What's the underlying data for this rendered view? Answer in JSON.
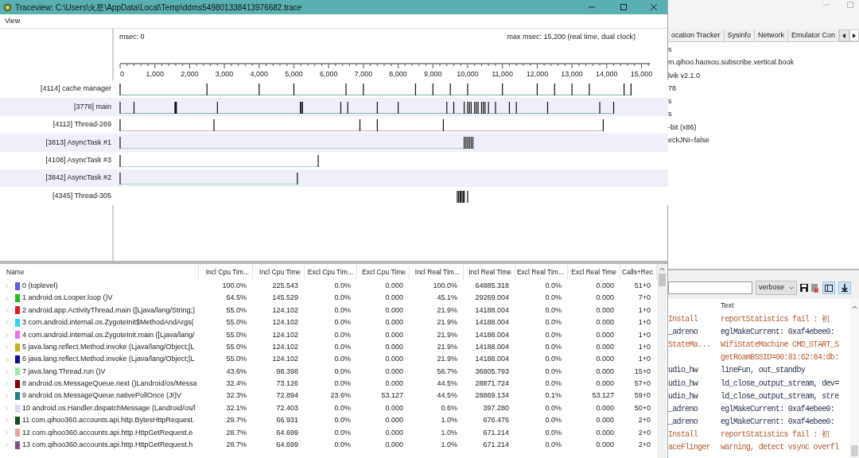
{
  "window": {
    "title": "Traceview: C:\\Users\\火星\\AppData\\Local\\Temp\\ddms549801338413976682.trace"
  },
  "menu": [
    "View"
  ],
  "timeline": {
    "msec": "msec: 0",
    "max_msec": "max msec: 15,200 (real time, dual clock)",
    "axis_labels": [
      "0",
      "1,000",
      "2,000",
      "3,000",
      "4,000",
      "5,000",
      "6,000",
      "7,000",
      "8,000",
      "9,000",
      "10,000",
      "11,000",
      "12,000",
      "13,000",
      "14,000",
      "15,000"
    ],
    "threads": [
      {
        "label": "[4114] cache manager"
      },
      {
        "label": "[3778] main"
      },
      {
        "label": "[4112] Thread-269"
      },
      {
        "label": "[3813] AsyncTask #1"
      },
      {
        "label": "[4108] AsyncTask #3"
      },
      {
        "label": "[3842] AsyncTask #2"
      },
      {
        "label": "[4345] Thread-305"
      }
    ]
  },
  "profile_table": {
    "columns": [
      "Name",
      "Incl Cpu Tim...",
      "Incl Cpu Time",
      "Excl Cpu Tim...",
      "Excl Cpu Time",
      "Incl Real Tim...",
      "Incl Real Time",
      "Excl Real Tim...",
      "Excl Real Time",
      "Calls+Rec"
    ],
    "rows": [
      {
        "color": "#5f5fe6",
        "cells": [
          "0 (toplevel)",
          "100.0%",
          "225.543",
          "0.0%",
          "0.000",
          "100.0%",
          "64885.318",
          "0.0%",
          "0.000",
          "51+0"
        ]
      },
      {
        "color": "#1fc01f",
        "cells": [
          "1 android.os.Looper.loop ()V",
          "64.5%",
          "145.529",
          "0.0%",
          "0.000",
          "45.1%",
          "29269.004",
          "0.0%",
          "0.000",
          "7+0"
        ]
      },
      {
        "color": "#e01f1f",
        "cells": [
          "2 android.app.ActivityThread.main ([Ljava/lang/String;)",
          "55.0%",
          "124.102",
          "0.0%",
          "0.000",
          "21.9%",
          "14188.004",
          "0.0%",
          "0.000",
          "1+0"
        ]
      },
      {
        "color": "#2fd4f2",
        "cells": [
          "3 com.android.internal.os.ZygoteInit$MethodAndArgs(",
          "55.0%",
          "124.102",
          "0.0%",
          "0.000",
          "21.9%",
          "14188.004",
          "0.0%",
          "0.000",
          "1+0"
        ]
      },
      {
        "color": "#f070ec",
        "cells": [
          "4 com.android.internal.os.ZygoteInit.main ([Ljava/lang/",
          "55.0%",
          "124.102",
          "0.0%",
          "0.000",
          "21.9%",
          "14188.004",
          "0.0%",
          "0.000",
          "1+0"
        ]
      },
      {
        "color": "#c8b01e",
        "cells": [
          "5 java.lang.reflect.Method.invoke (Ljava/lang/Object;[L",
          "55.0%",
          "124.102",
          "0.0%",
          "0.000",
          "21.9%",
          "14188.004",
          "0.0%",
          "0.000",
          "1+0"
        ]
      },
      {
        "color": "#10109e",
        "cells": [
          "6 java.lang.reflect.Method.invoke (Ljava/lang/Object;[L",
          "55.0%",
          "124.102",
          "0.0%",
          "0.000",
          "21.9%",
          "14188.004",
          "0.0%",
          "0.000",
          "1+0"
        ]
      },
      {
        "color": "#a2e8a2",
        "cells": [
          "7 java.lang.Thread.run ()V",
          "43.6%",
          "98.398",
          "0.0%",
          "0.000",
          "56.7%",
          "36805.793",
          "0.0%",
          "0.000",
          "15+0"
        ]
      },
      {
        "color": "#800000",
        "cells": [
          "8 android.os.MessageQueue.next ()Landroid/os/Messa",
          "32.4%",
          "73.126",
          "0.0%",
          "0.000",
          "44.5%",
          "28871.724",
          "0.0%",
          "0.000",
          "57+0"
        ]
      },
      {
        "color": "#1f7f8f",
        "cells": [
          "9 android.os.MessageQueue.nativePollOnce (JI)V",
          "32.3%",
          "72.894",
          "23.6%",
          "53.127",
          "44.5%",
          "28869.134",
          "0.1%",
          "53.127",
          "59+0"
        ]
      },
      {
        "color": "#d8d8f2",
        "cells": [
          "10 android.os.Handler.dispatchMessage (Landroid/os/l",
          "32.1%",
          "72.403",
          "0.0%",
          "0.000",
          "0.6%",
          "397.280",
          "0.0%",
          "0.000",
          "50+0"
        ]
      },
      {
        "color": "#0f4f0f",
        "cells": [
          "11 com.qihoo360.accounts.api.http.BytesHttpRequest.",
          "29.7%",
          "66.931",
          "0.0%",
          "0.000",
          "1.0%",
          "676.476",
          "0.0%",
          "0.000",
          "2+0"
        ]
      },
      {
        "color": "#f2a2a2",
        "cells": [
          "12 com.qihoo360.accounts.api.http.HttpGetRequest.e",
          "28.7%",
          "64.699",
          "0.0%",
          "0.000",
          "1.0%",
          "671.214",
          "0.0%",
          "0.000",
          "2+0"
        ]
      },
      {
        "color": "#805080",
        "cells": [
          "13 com.qihoo360.accounts.api.http.HttpGetRequest.h",
          "28.7%",
          "64.699",
          "0.0%",
          "0.000",
          "1.0%",
          "671.214",
          "0.0%",
          "0.000",
          "2+0"
        ]
      }
    ]
  },
  "ddms": {
    "tabs": [
      "ocation Tracker",
      "Sysinfo",
      "Network",
      "Emulator Con"
    ],
    "info_lines": [
      "s",
      "m.qihoo.haosou.subscribe.vertical.book",
      "lvik v2.1.0",
      "78",
      "s",
      "s",
      "-bit (x86)",
      "eckJNI=false"
    ],
    "log": {
      "level": "verbose",
      "columns": [
        "Text"
      ],
      "rows": [
        {
          "tag": "Install",
          "text": "reportStatistics fail : 初",
          "kind": "warn"
        },
        {
          "tag": "_adreno",
          "text": "eglMakeCurrent: 0xaf4ebee0:",
          "kind": "debug"
        },
        {
          "tag": "StateMa...",
          "text": "WifiStateMachine CMD_START_S",
          "kind": "warn"
        },
        {
          "text": "getRoamBSSID=00:81:62:84:db:",
          "kind": "warn"
        },
        {
          "tag": "udio_hw",
          "text": "lineFun, out_standby",
          "kind": "debug"
        },
        {
          "tag": "udio_hw",
          "text": "ld_close_output_stream, dev=",
          "kind": "debug"
        },
        {
          "tag": "udio_hw",
          "text": "ld_close_output_stream, stre",
          "kind": "debug"
        },
        {
          "tag": "_adreno",
          "text": "eglMakeCurrent: 0xaf4ebee0:",
          "kind": "debug"
        },
        {
          "tag": "_adreno",
          "text": "eglMakeCurrent: 0xaf4ebee0:",
          "kind": "debug"
        },
        {
          "tag": "Install",
          "text": "reportStatistics fail : 初",
          "kind": "warn"
        },
        {
          "tag": "aceFlinger",
          "text": "warning, detect vsync overfl",
          "kind": "warn"
        }
      ]
    }
  }
}
